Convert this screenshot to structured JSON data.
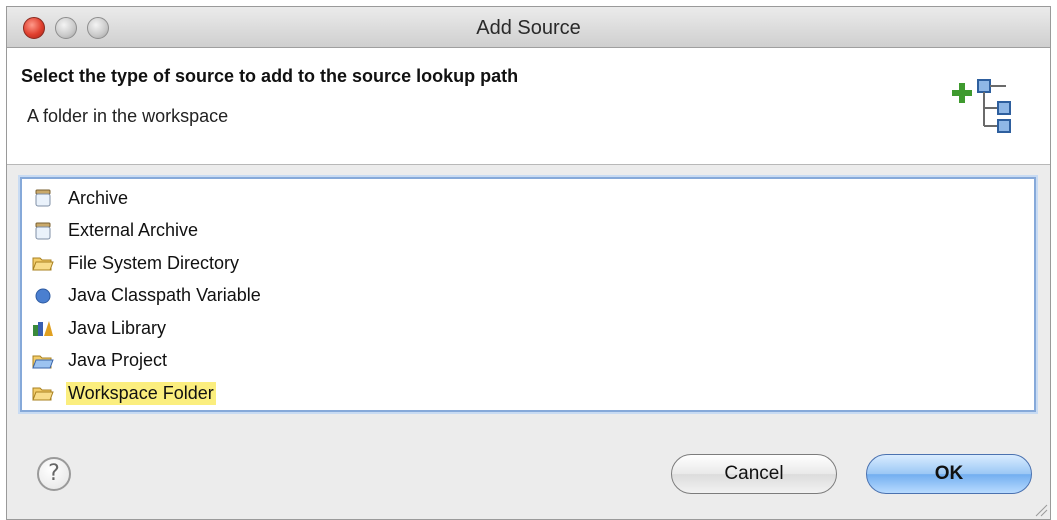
{
  "window": {
    "title": "Add Source"
  },
  "header": {
    "title": "Select the type of source to add to the source lookup path",
    "description": "A folder in the workspace",
    "icon": "add-source-tree-icon"
  },
  "list": {
    "items": [
      {
        "label": "Archive",
        "icon": "jar-icon"
      },
      {
        "label": "External Archive",
        "icon": "jar-icon"
      },
      {
        "label": "File System Directory",
        "icon": "folder-open-icon"
      },
      {
        "label": "Java Classpath Variable",
        "icon": "blue-dot-icon"
      },
      {
        "label": "Java Library",
        "icon": "library-icon"
      },
      {
        "label": "Java Project",
        "icon": "java-project-icon"
      },
      {
        "label": "Workspace Folder",
        "icon": "folder-open-icon",
        "selected": true
      }
    ]
  },
  "footer": {
    "help_glyph": "?",
    "cancel_label": "Cancel",
    "ok_label": "OK"
  },
  "colors": {
    "selection_highlight": "#fbee7e",
    "default_button": "#72aef0",
    "list_border": "#86a9d9"
  }
}
